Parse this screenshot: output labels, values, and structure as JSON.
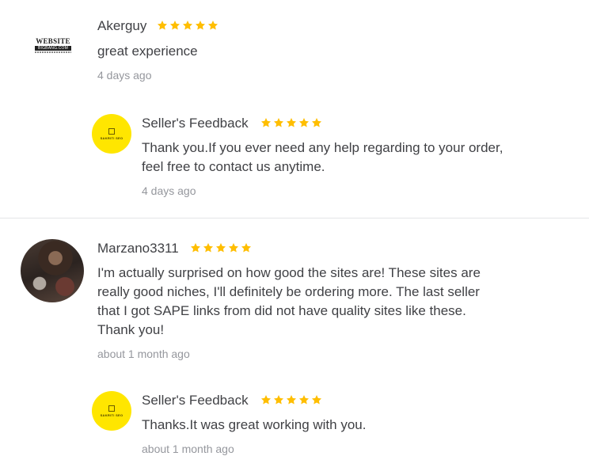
{
  "reviews": [
    {
      "username": "Akerguy",
      "rating": 5,
      "text": "great experience",
      "time": "4 days ago",
      "avatar_logo": {
        "line1": "WEBSITE",
        "line2": "BIGBANG.COM"
      },
      "seller_feedback": {
        "title": "Seller's Feedback",
        "rating": 5,
        "text": "Thank you.If you ever need any help regarding to your order, feel free to contact us anytime.",
        "time": "4 days ago"
      }
    },
    {
      "username": "Marzano3311",
      "rating": 5,
      "text": "I'm actually surprised on how good the sites are! These sites are really good niches, I'll definitely be ordering more. The last seller that I got SAPE links from did not have quality sites like these. Thank you!",
      "time": "about 1 month ago",
      "seller_feedback": {
        "title": "Seller's Feedback",
        "rating": 5,
        "text": "Thanks.It was great working with you.",
        "time": "about 1 month ago"
      }
    }
  ],
  "seller_logo": {
    "name": "SAKRITI SEO",
    "sub": ""
  },
  "colors": {
    "star": "#ffbe00",
    "seller_avatar_bg": "#ffe600",
    "text": "#404145",
    "muted": "#95979d",
    "divider": "#e4e5e7"
  },
  "icons": {
    "star": "star-icon"
  }
}
